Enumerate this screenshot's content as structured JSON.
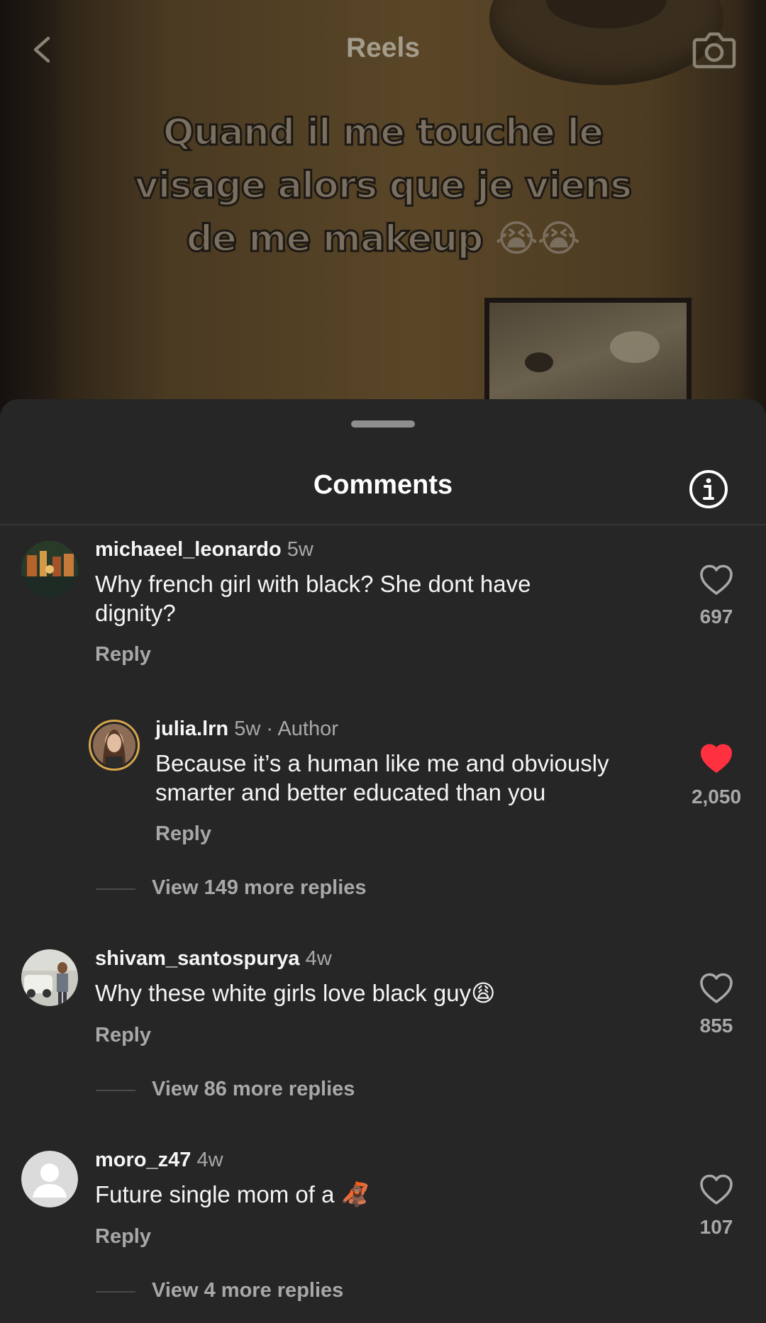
{
  "header": {
    "title": "Reels",
    "caption_line1": "Quand il me touche le",
    "caption_line2": "visage alors que je viens",
    "caption_line3": "de me makeup",
    "caption_emoji": "😭😭"
  },
  "sheet": {
    "title": "Comments"
  },
  "comments": [
    {
      "username": "michaeel_leonardo",
      "meta": "5w",
      "text": "Why french girl with black? She dont have dignity?",
      "reply_label": "Reply",
      "likes": "697",
      "liked": false
    },
    {
      "username": "julia.lrn",
      "meta": "5w · Author",
      "text": "Because it’s a human like me and obviously smarter and better educated than you",
      "reply_label": "Reply",
      "likes": "2,050",
      "liked": true,
      "view_more": "View 149 more replies"
    },
    {
      "username": "shivam_santospurya",
      "meta": "4w",
      "text": "Why these white girls love black guy",
      "text_emoji": "😩",
      "reply_label": "Reply",
      "likes": "855",
      "liked": false,
      "view_more": "View 86 more replies"
    },
    {
      "username": "moro_z47",
      "meta": "4w",
      "text": "Future single mom of a ",
      "text_emoji": "🦧",
      "reply_label": "Reply",
      "likes": "107",
      "liked": false,
      "view_more": "View 4 more replies"
    }
  ],
  "colors": {
    "sheet_bg": "#262626",
    "secondary_text": "#a8a8a8",
    "liked_heart": "#ff3040"
  }
}
